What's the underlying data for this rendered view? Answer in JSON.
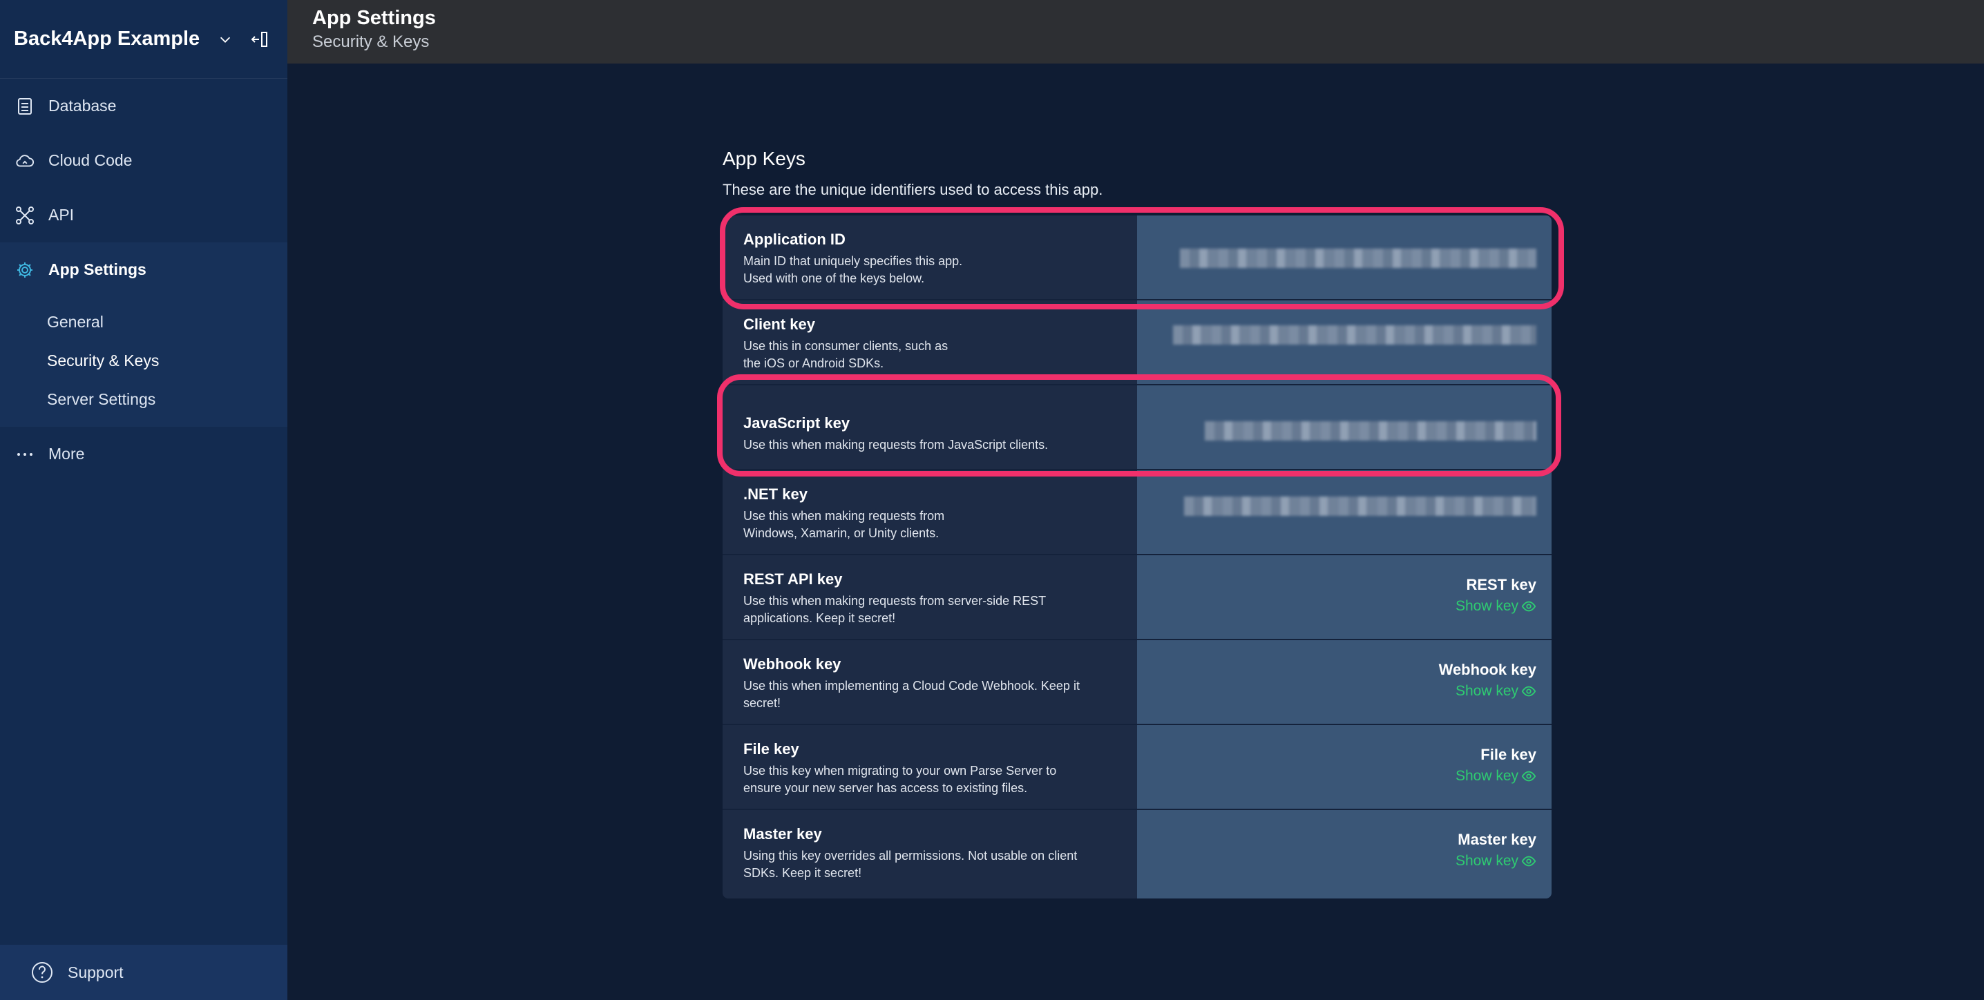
{
  "sidebar": {
    "app_name": "Back4App Example",
    "nav": [
      {
        "label": "Database",
        "icon": "database-icon"
      },
      {
        "label": "Cloud Code",
        "icon": "cloud-code-icon"
      },
      {
        "label": "API",
        "icon": "api-icon"
      },
      {
        "label": "App Settings",
        "icon": "gear-icon",
        "active": true
      },
      {
        "label": "More",
        "icon": "more-icon"
      }
    ],
    "subnav": [
      {
        "label": "General"
      },
      {
        "label": "Security & Keys",
        "active": true
      },
      {
        "label": "Server Settings"
      }
    ],
    "support_label": "Support"
  },
  "header": {
    "title": "App Settings",
    "subtitle": "Security & Keys"
  },
  "main": {
    "title": "App Keys",
    "description": "These are the unique identifiers used to access this app.",
    "keys": [
      {
        "name": "Application ID",
        "desc_lines": [
          "Main ID that uniquely specifies this app.",
          "Used with one of the keys below."
        ],
        "value_hidden": true,
        "highlighted": true
      },
      {
        "name": "Client key",
        "desc_lines": [
          "Use this in consumer clients, such as",
          "the iOS or Android SDKs."
        ],
        "value_hidden": true
      },
      {
        "name": "JavaScript key",
        "desc_lines": [
          "Use this when making requests from JavaScript clients."
        ],
        "value_hidden": true,
        "highlighted": true
      },
      {
        "name": ".NET key",
        "desc_lines": [
          "Use this when making requests from",
          "Windows, Xamarin, or Unity clients."
        ],
        "value_hidden": true
      },
      {
        "name": "REST API key",
        "desc_lines": [
          "Use this when making requests from server-side REST",
          "applications. Keep it secret!"
        ],
        "right_label": "REST key",
        "show_label": "Show key"
      },
      {
        "name": "Webhook key",
        "desc_lines": [
          "Use this when implementing a Cloud Code Webhook. Keep it",
          "secret!"
        ],
        "right_label": "Webhook key",
        "show_label": "Show key"
      },
      {
        "name": "File key",
        "desc_lines": [
          "Use this key when migrating to your own Parse Server to",
          "ensure your new server has access to existing files."
        ],
        "right_label": "File key",
        "show_label": "Show key"
      },
      {
        "name": "Master key",
        "desc_lines": [
          "Using this key overrides all permissions. Not usable on client",
          "SDKs. Keep it secret!"
        ],
        "right_label": "Master key",
        "show_label": "Show key"
      }
    ]
  },
  "colors": {
    "highlight": "#f0306b",
    "show_key": "#2ecc71",
    "sidebar_bg": "#132b50",
    "main_bg": "#0f1c33"
  }
}
